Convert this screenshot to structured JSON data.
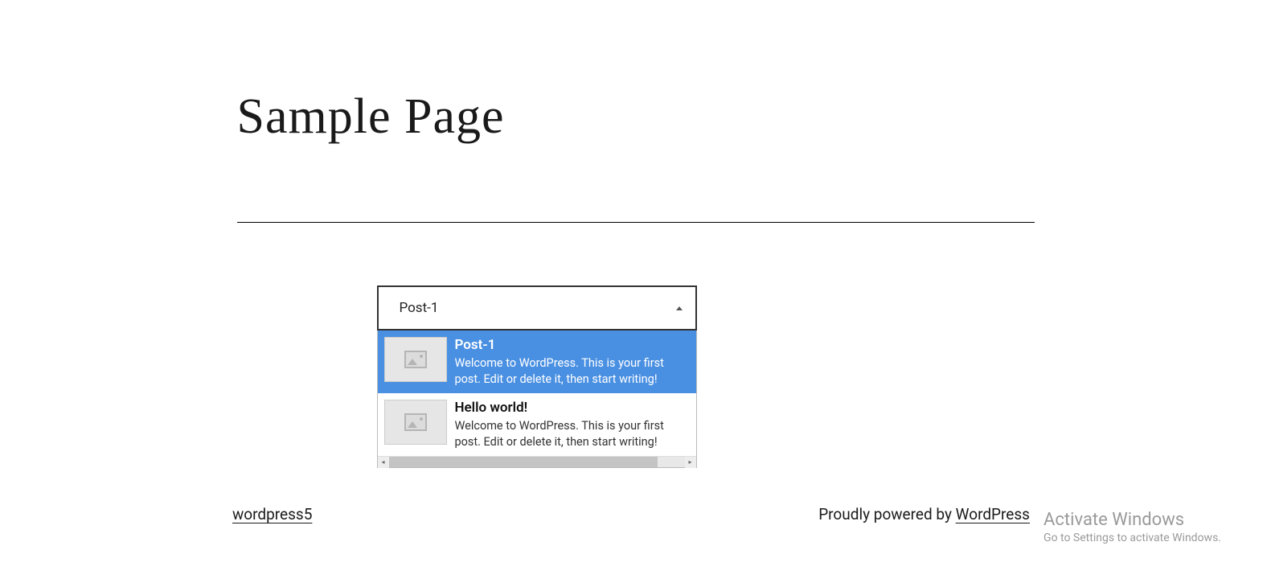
{
  "page": {
    "title": "Sample Page"
  },
  "dropdown": {
    "selected_label": "Post-1",
    "options": [
      {
        "title": "Post-1",
        "description": "Welcome to WordPress. This is your first post. Edit or delete it, then start writing!",
        "selected": true
      },
      {
        "title": "Hello world!",
        "description": "Welcome to WordPress. This is your first post. Edit or delete it, then start writing!",
        "selected": false
      }
    ]
  },
  "footer": {
    "site_link": "wordpress5",
    "powered_text": "Proudly powered by ",
    "powered_link": "WordPress"
  },
  "watermark": {
    "title": "Activate Windows",
    "subtitle": "Go to Settings to activate Windows."
  }
}
